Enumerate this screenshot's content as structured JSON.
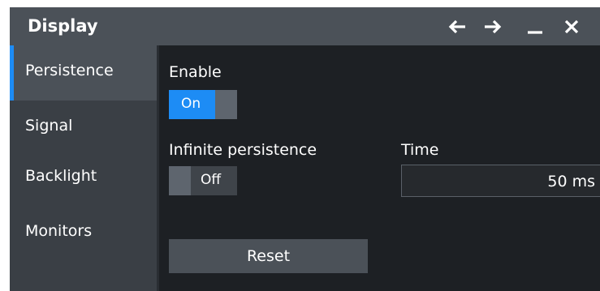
{
  "window": {
    "title": "Display",
    "controls": [
      "back-arrow-icon",
      "forward-arrow-icon",
      "minimize-icon",
      "close-icon"
    ]
  },
  "sidebar": {
    "items": [
      {
        "label": "Persistence",
        "active": true
      },
      {
        "label": "Signal",
        "active": false
      },
      {
        "label": "Backlight",
        "active": false
      },
      {
        "label": "Monitors",
        "active": false
      }
    ]
  },
  "main": {
    "enable_label": "Enable",
    "enable_toggle": {
      "value": "On",
      "state": true
    },
    "infinite_label": "Infinite persistence",
    "infinite_toggle": {
      "value": "Off",
      "state": false
    },
    "time_label": "Time",
    "time_value": "50 ms",
    "reset_label": "Reset"
  },
  "colors": {
    "accent": "#1d8cf5",
    "titlebar": "#4b5158",
    "sidebar": "#3a3f45",
    "background": "#1d2024"
  }
}
